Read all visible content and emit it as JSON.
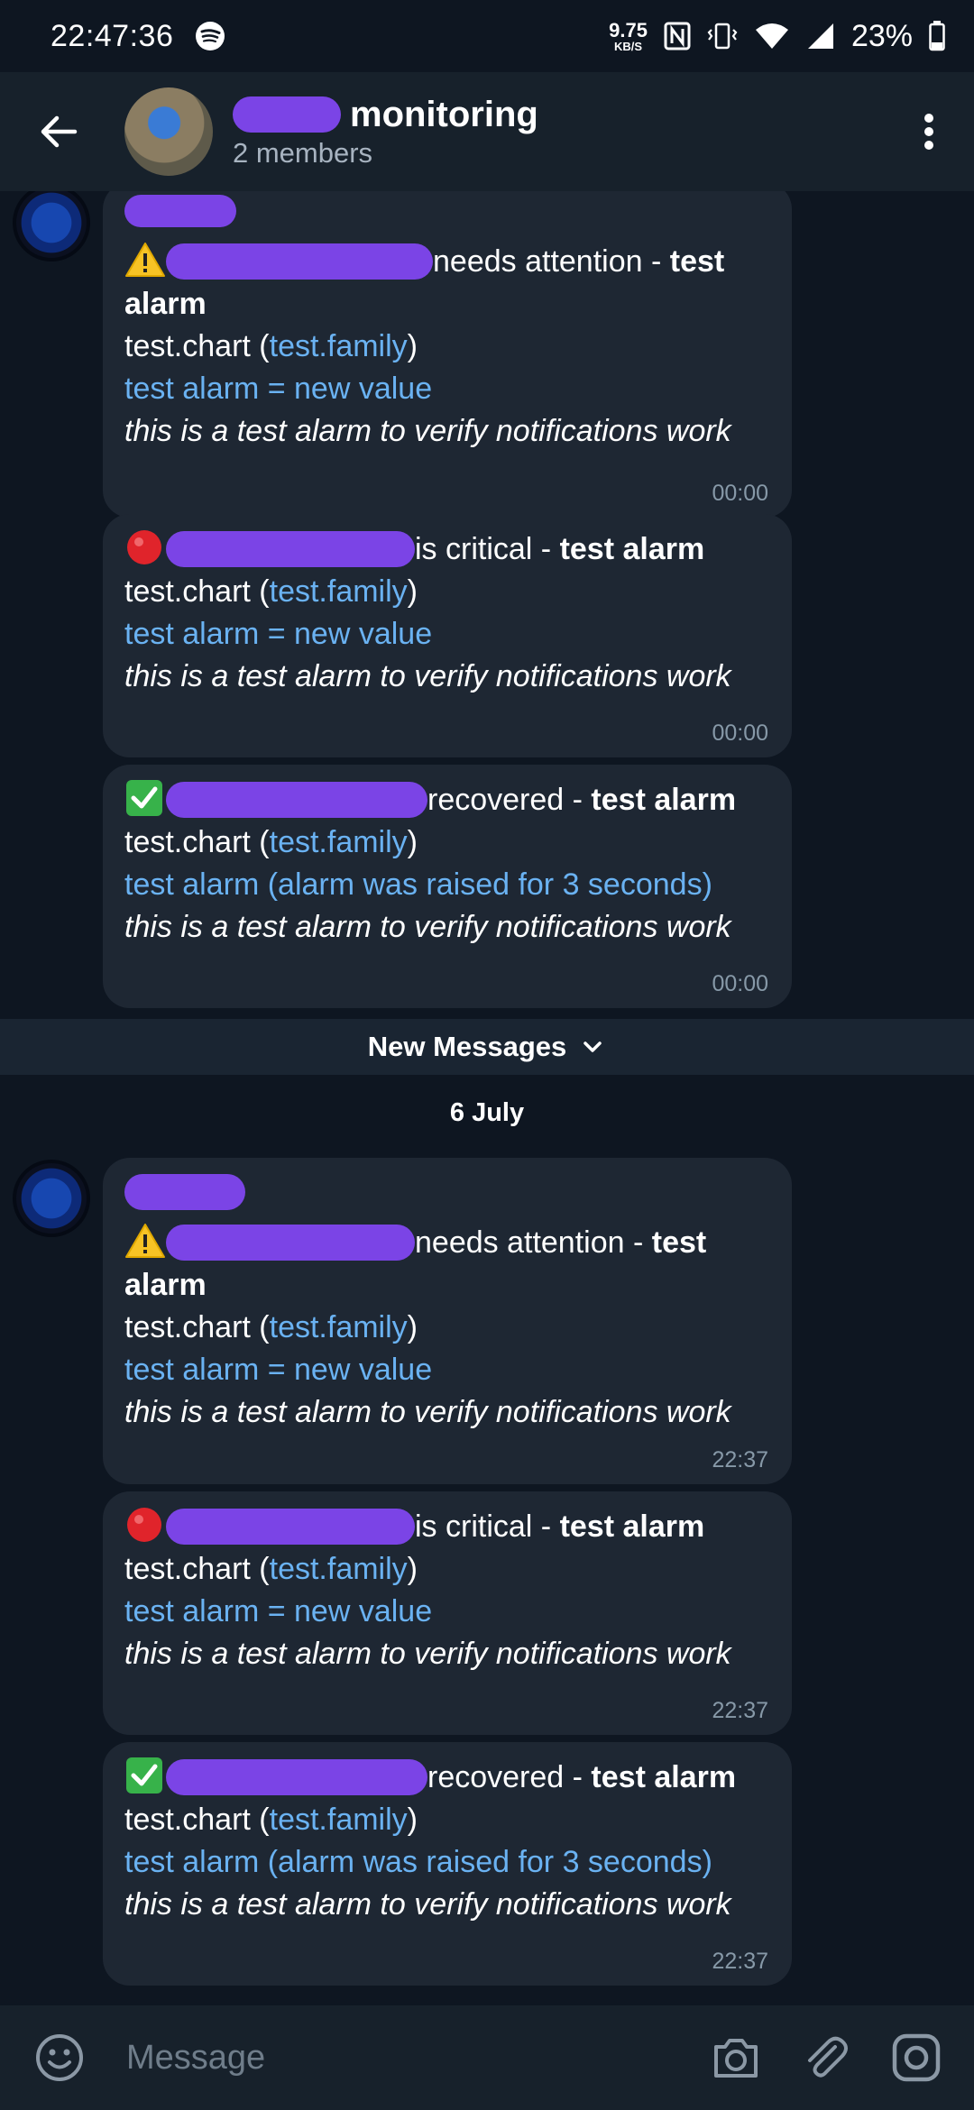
{
  "status_bar": {
    "time": "22:47:36",
    "net_speed": "9.75",
    "net_unit": "KB/S",
    "battery": "23%"
  },
  "header": {
    "title": "monitoring",
    "subtitle": "2 members"
  },
  "banner": {
    "new_messages": "New Messages"
  },
  "date_separator": "6 July",
  "messages": [
    {
      "status": "needs attention",
      "sep": " - ",
      "alarm_a": "test",
      "alarm_b": "alarm",
      "chart": "test.chart",
      "family": "test.family",
      "value_line": "test alarm = new value",
      "info": "this is a test alarm to verify notifications work",
      "time": "00:00"
    },
    {
      "status": "is critical",
      "sep": " - ",
      "alarm": "test alarm",
      "chart": "test.chart",
      "family": "test.family",
      "value_line": "test alarm = new value",
      "info": "this is a test alarm to verify notifications work",
      "time": "00:00"
    },
    {
      "status": "recovered",
      "sep": " - ",
      "alarm": "test alarm",
      "chart": "test.chart",
      "family": "test.family",
      "value_line": "test alarm (alarm was raised for 3 seconds)",
      "info": "this is a test alarm to verify notifications work",
      "time": "00:00"
    },
    {
      "status": "needs attention",
      "sep": " - ",
      "alarm_a": "test",
      "alarm_b": "alarm",
      "chart": "test.chart",
      "family": "test.family",
      "value_line": "test alarm = new value",
      "info": "this is a test alarm to verify notifications work",
      "time": "22:37"
    },
    {
      "status": "is critical",
      "sep": " - ",
      "alarm": "test alarm",
      "chart": "test.chart",
      "family": "test.family",
      "value_line": "test alarm = new value",
      "info": "this is a test alarm to verify notifications work",
      "time": "22:37"
    },
    {
      "status": "recovered",
      "sep": " - ",
      "alarm": "test alarm",
      "chart": "test.chart",
      "family": "test.family",
      "value_line": "test alarm (alarm was raised for 3 seconds)",
      "info": "this is a test alarm to verify notifications work",
      "time": "22:37"
    }
  ],
  "composer": {
    "placeholder": "Message"
  },
  "icons": {
    "warning": "warning-icon",
    "critical": "red-circle-icon",
    "recovered": "check-mark-icon"
  },
  "colors": {
    "background": "#0e1621",
    "header": "#17212b",
    "bubble": "#1e2733",
    "link": "#6ab2f2",
    "redaction": "#7b44e6"
  }
}
